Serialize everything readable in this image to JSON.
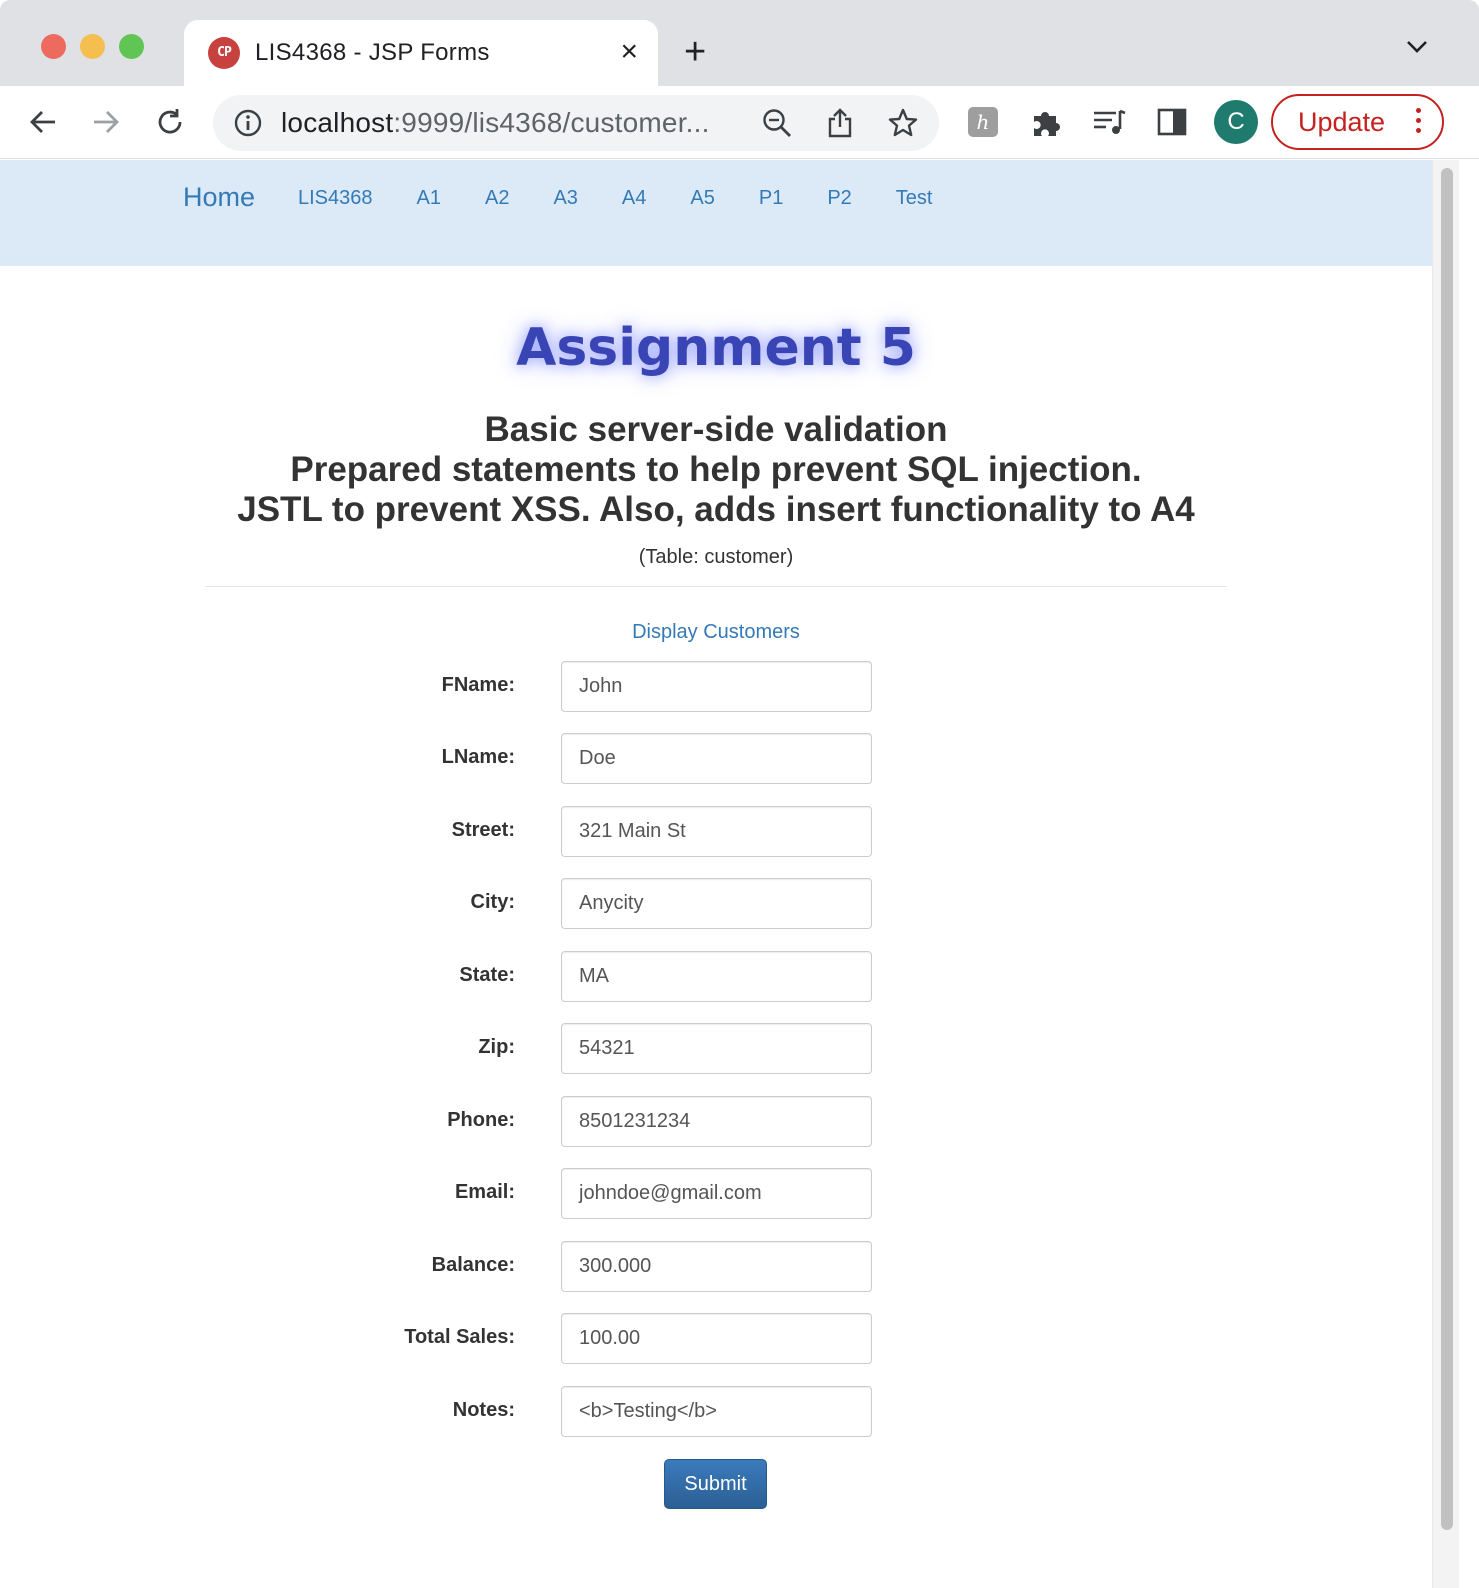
{
  "browser": {
    "tab_title": "LIS4368 - JSP Forms",
    "tab_favicon_text": "CP",
    "tab_close": "×",
    "new_tab": "+",
    "url_host": "localhost",
    "url_rest": ":9999/lis4368/customer...",
    "profile_initial": "C",
    "update_label": "Update",
    "icons": [
      "back-icon",
      "forward-icon",
      "reload-icon",
      "info-icon",
      "zoom-out-icon",
      "share-icon",
      "bookmark-star-icon",
      "extension-h-icon",
      "puzzle-icon",
      "media-queue-icon",
      "side-panel-icon",
      "tab-search-chevron-icon"
    ]
  },
  "navbar": {
    "brand": "Home",
    "links": [
      "LIS4368",
      "A1",
      "A2",
      "A3",
      "A4",
      "A5",
      "P1",
      "P2",
      "Test"
    ]
  },
  "header": {
    "title": "Assignment 5",
    "subtitle_lines": [
      "Basic server-side validation",
      "Prepared statements to help prevent SQL injection.",
      "JSTL to prevent XSS. Also, adds insert functionality to A4"
    ],
    "table_note": "(Table: customer)"
  },
  "display_link": "Display Customers",
  "form": {
    "fields": [
      {
        "label": "FName:",
        "value": "John"
      },
      {
        "label": "LName:",
        "value": "Doe"
      },
      {
        "label": "Street:",
        "value": "321 Main St"
      },
      {
        "label": "City:",
        "value": "Anycity"
      },
      {
        "label": "State:",
        "value": "MA"
      },
      {
        "label": "Zip:",
        "value": "54321"
      },
      {
        "label": "Phone:",
        "value": "8501231234"
      },
      {
        "label": "Email:",
        "value": "johndoe@gmail.com"
      },
      {
        "label": "Balance:",
        "value": "300.000"
      },
      {
        "label": "Total Sales:",
        "value": "100.00"
      },
      {
        "label": "Notes:",
        "value": "<b>Testing</b>"
      }
    ],
    "submit_label": "Submit"
  },
  "colors": {
    "link": "#337ab7",
    "navbar_bg": "#dce9f6",
    "title": "#3a45b5",
    "submit_bg": "#2e6da4",
    "update": "#c5221f"
  }
}
